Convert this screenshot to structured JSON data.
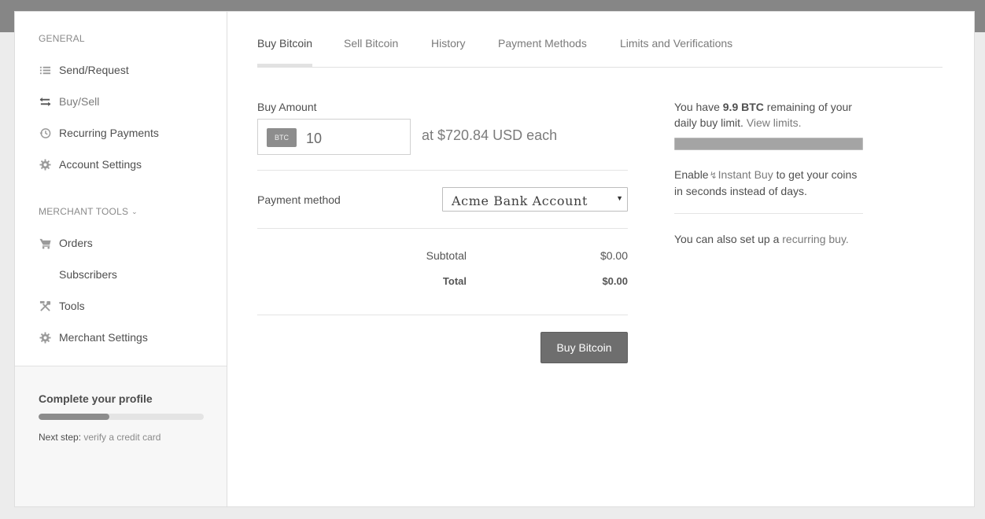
{
  "sidebar": {
    "general_title": "GENERAL",
    "general_items": [
      {
        "label": "Send/Request",
        "icon": "list-icon"
      },
      {
        "label": "Buy/Sell",
        "icon": "exchange-icon"
      },
      {
        "label": "Recurring Payments",
        "icon": "history-icon"
      },
      {
        "label": "Account Settings",
        "icon": "gear-icon"
      }
    ],
    "merchant_title": "MERCHANT TOOLS",
    "merchant_items": [
      {
        "label": "Orders",
        "icon": "cart-icon"
      },
      {
        "label": "Subscribers",
        "icon": ""
      },
      {
        "label": "Tools",
        "icon": "tools-icon"
      },
      {
        "label": "Merchant Settings",
        "icon": "gear-icon"
      }
    ],
    "active_item": "Buy/Sell"
  },
  "profile": {
    "title": "Complete your profile",
    "progress": 0.43,
    "next_step_label": "Next step:",
    "next_step_text": "verify a credit card"
  },
  "tabs": [
    {
      "label": "Buy Bitcoin",
      "active": true
    },
    {
      "label": "Sell Bitcoin",
      "active": false
    },
    {
      "label": "History",
      "active": false
    },
    {
      "label": "Payment Methods",
      "active": false
    },
    {
      "label": "Limits and Verifications",
      "active": false
    }
  ],
  "buy_form": {
    "amount_label": "Buy Amount",
    "currency_badge": "BTC",
    "amount_value": "10",
    "rate_text": "at $720.84 USD each",
    "payment_label": "Payment method",
    "payment_selected": "Acme Bank Account",
    "subtotal_label": "Subtotal",
    "subtotal_value": "$0.00",
    "total_label": "Total",
    "total_value": "$0.00",
    "buy_button": "Buy Bitcoin"
  },
  "side_info": {
    "limit_prefix": "You have",
    "limit_amount": "9.9 BTC",
    "limit_suffix": "remaining of your daily buy limit.",
    "view_limits_link": "View limits.",
    "limit_fill": 0.99,
    "instant_prefix": "Enable",
    "instant_link": "Instant Buy",
    "instant_suffix": "to get your coins in seconds instead of days.",
    "recurring_prefix": "You can also set up a",
    "recurring_link": "recurring buy."
  },
  "colors": {
    "topbar": "#868686",
    "button": "#6e6e6e",
    "background": "#ececec"
  }
}
